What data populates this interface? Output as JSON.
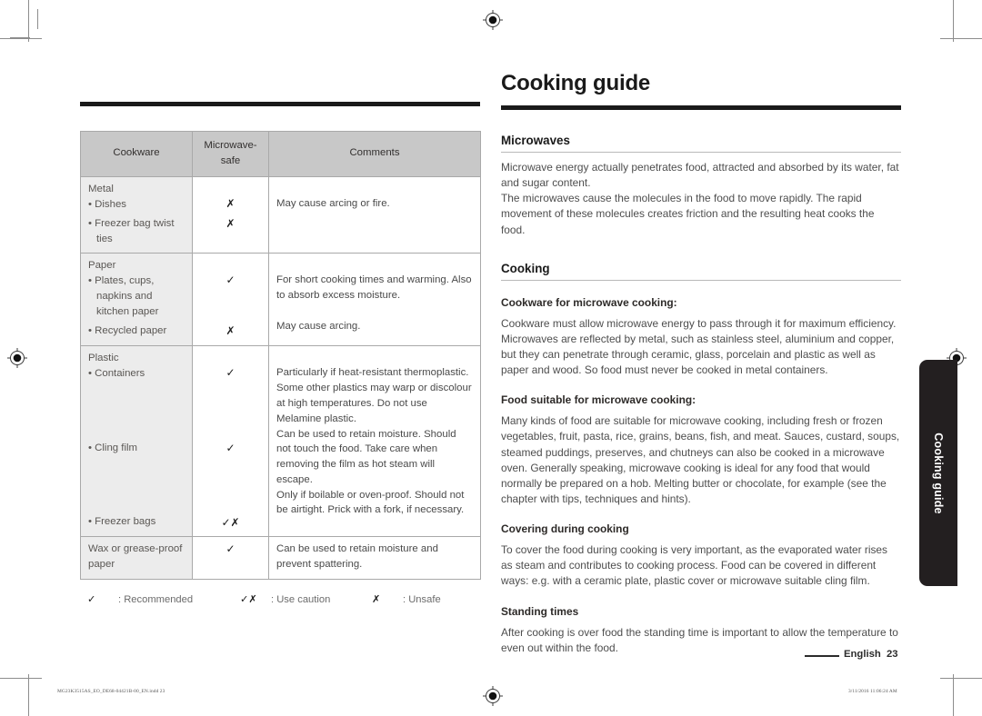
{
  "header": {
    "title": "Cooking guide"
  },
  "side_tab": {
    "label": "Cooking guide"
  },
  "table": {
    "headers": [
      "Cookware",
      "Microwave-safe",
      "Comments"
    ],
    "header_microwave_line1": "Microwave-",
    "header_microwave_line2": "safe",
    "rows": [
      {
        "category": "Metal",
        "items": [
          {
            "label": "Dishes",
            "mark": "x"
          },
          {
            "label": "Freezer bag twist ties",
            "mark": "x"
          }
        ],
        "comment": "May cause arcing or fire."
      },
      {
        "category": "Paper",
        "items": [
          {
            "label": "Plates, cups, napkins and kitchen paper",
            "mark": "check"
          },
          {
            "label": "Recycled paper",
            "mark": "x"
          }
        ],
        "comments": [
          "For short cooking times and warming. Also to absorb excess moisture.",
          "May cause arcing."
        ]
      },
      {
        "category": "Plastic",
        "items": [
          {
            "label": "Containers",
            "mark": "check"
          },
          {
            "label": "Cling film",
            "mark": "check"
          },
          {
            "label": "Freezer bags",
            "mark": "check-x"
          }
        ],
        "comments": [
          "Particularly if heat-resistant thermoplastic. Some other plastics may warp or discolour at high temperatures. Do not use Melamine plastic.",
          "Can be used to retain moisture. Should not touch the food. Take care when removing the film as hot steam will escape.",
          "Only if boilable or oven-proof. Should not be airtight. Prick with a fork, if necessary."
        ]
      },
      {
        "category": "Wax or grease-proof paper",
        "mark": "check",
        "comment": "Can be used to retain moisture and prevent spattering."
      }
    ]
  },
  "legend": [
    {
      "symbol": "✓",
      "text": ": Recommended"
    },
    {
      "symbol": "✓✗",
      "text": ": Use caution"
    },
    {
      "symbol": "✗",
      "text": ": Unsafe"
    }
  ],
  "sections": [
    {
      "heading": "Microwaves",
      "paragraphs": [
        "Microwave energy actually penetrates food, attracted and absorbed by its water, fat and sugar content.",
        "The microwaves cause the molecules in the food to move rapidly. The rapid movement of these molecules creates friction and the resulting heat cooks the food."
      ]
    },
    {
      "heading": "Cooking",
      "subsections": [
        {
          "title": "Cookware for microwave cooking:",
          "body": "Cookware must allow microwave energy to pass through it for maximum efficiency. Microwaves are reflected by metal, such as stainless steel, aluminium and copper, but they can penetrate through ceramic, glass, porcelain and plastic as well as paper and wood. So food must never be cooked in metal containers."
        },
        {
          "title": "Food suitable for microwave cooking:",
          "body": "Many kinds of food are suitable for microwave cooking, including fresh or frozen vegetables, fruit, pasta, rice, grains, beans, fish, and meat. Sauces, custard, soups, steamed puddings, preserves, and chutneys can also be cooked in a microwave oven. Generally speaking, microwave cooking is ideal for any food that would normally be prepared on a hob. Melting butter or chocolate, for example (see the chapter with tips, techniques and hints)."
        },
        {
          "title": "Covering during cooking",
          "body": "To cover the food during cooking is very important, as the evaporated water rises as steam and contributes to cooking process. Food can be covered in different ways: e.g. with a ceramic plate, plastic cover or microwave suitable cling film."
        },
        {
          "title": "Standing times",
          "body": "After cooking is over food the standing time is important to allow the temperature to even out within the food."
        }
      ]
    }
  ],
  "footer": {
    "language": "English",
    "page_number": "23",
    "print_filename": "MG23K3515AS_EO_DE68-04421B-00_EN.indd   23",
    "print_timestamp": "3/11/2016   11:06:24 AM"
  },
  "colors": {
    "rule": "#1a1a1a",
    "table_header_bg": "#c8c8c8",
    "table_category_bg": "#ececec",
    "side_tab_bg": "#231f20"
  }
}
